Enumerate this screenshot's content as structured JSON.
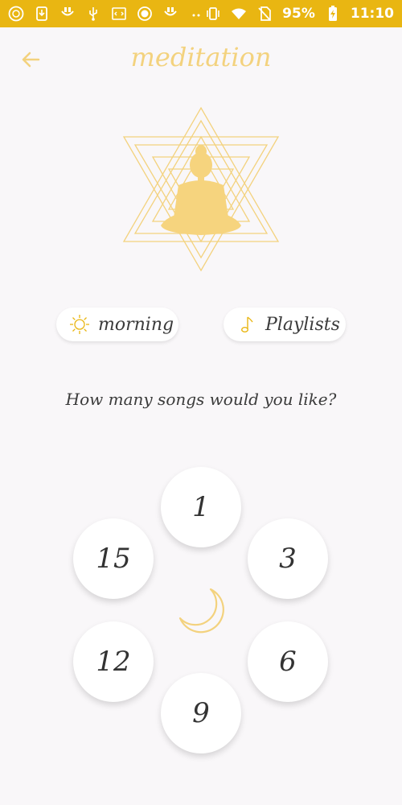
{
  "status_bar": {
    "battery": "95%",
    "time": "11:10"
  },
  "header": {
    "title": "meditation"
  },
  "chips": {
    "morning": {
      "label": "morning",
      "icon": "sun-icon"
    },
    "playlists": {
      "label": "Playlists",
      "icon": "music-note-icon"
    }
  },
  "question": "How many songs would you like?",
  "options": [
    "1",
    "3",
    "6",
    "9",
    "12",
    "15"
  ],
  "colors": {
    "status_bar": "#e9b612",
    "accent": "#f3d27e",
    "background": "#f9f7f9"
  }
}
